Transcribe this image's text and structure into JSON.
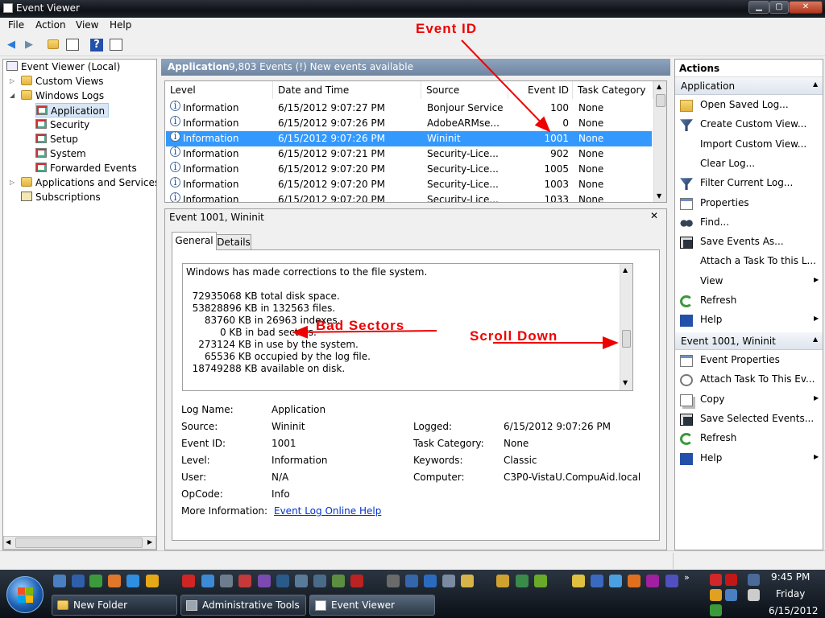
{
  "window": {
    "title": "Event Viewer",
    "min": "▁",
    "max": "▢",
    "close": "✕"
  },
  "menu": [
    "File",
    "Action",
    "View",
    "Help"
  ],
  "tree": {
    "root": "Event Viewer (Local)",
    "custom_views": "Custom Views",
    "windows_logs": "Windows Logs",
    "logs": [
      "Application",
      "Security",
      "Setup",
      "System",
      "Forwarded Events"
    ],
    "apps_services": "Applications and Services Lo",
    "subscriptions": "Subscriptions"
  },
  "center_header": {
    "title": "Application",
    "info": "9,803 Events (!) New events available"
  },
  "events_table": {
    "columns": [
      "Level",
      "Date and Time",
      "Source",
      "Event ID",
      "Task Category"
    ],
    "rows": [
      {
        "level": "Information",
        "date": "6/15/2012 9:07:27 PM",
        "source": "Bonjour Service",
        "id": "100",
        "cat": "None"
      },
      {
        "level": "Information",
        "date": "6/15/2012 9:07:26 PM",
        "source": "AdobeARMse...",
        "id": "0",
        "cat": "None"
      },
      {
        "level": "Information",
        "date": "6/15/2012 9:07:26 PM",
        "source": "Wininit",
        "id": "1001",
        "cat": "None",
        "selected": true
      },
      {
        "level": "Information",
        "date": "6/15/2012 9:07:21 PM",
        "source": "Security-Lice...",
        "id": "902",
        "cat": "None"
      },
      {
        "level": "Information",
        "date": "6/15/2012 9:07:20 PM",
        "source": "Security-Lice...",
        "id": "1005",
        "cat": "None"
      },
      {
        "level": "Information",
        "date": "6/15/2012 9:07:20 PM",
        "source": "Security-Lice...",
        "id": "1003",
        "cat": "None"
      },
      {
        "level": "Information",
        "date": "6/15/2012 9:07:20 PM",
        "source": "Security-Lice...",
        "id": "1033",
        "cat": "None"
      }
    ]
  },
  "detail": {
    "title": "Event 1001, Wininit",
    "close": "✕",
    "tabs": [
      "General",
      "Details"
    ],
    "description": [
      "Windows has made corrections to the file system.",
      "",
      "  72935068 KB total disk space.",
      "  53828896 KB in 132563 files.",
      "      83760 KB in 26963 indexes.",
      "           0 KB in bad sectors.",
      "    273124 KB in use by the system.",
      "      65536 KB occupied by the log file.",
      "  18749288 KB available on disk."
    ],
    "fields_left": [
      {
        "label": "Log Name:",
        "value": "Application"
      },
      {
        "label": "Source:",
        "value": "Wininit"
      },
      {
        "label": "Event ID:",
        "value": "1001"
      },
      {
        "label": "Level:",
        "value": "Information"
      },
      {
        "label": "User:",
        "value": "N/A"
      },
      {
        "label": "OpCode:",
        "value": "Info"
      },
      {
        "label": "More Information:",
        "value": "Event Log Online Help"
      }
    ],
    "fields_right": [
      {
        "label": "Logged:",
        "value": "6/15/2012 9:07:26 PM"
      },
      {
        "label": "Task Category:",
        "value": "None"
      },
      {
        "label": "Keywords:",
        "value": "Classic"
      },
      {
        "label": "Computer:",
        "value": "C3P0-VistaU.CompuAid.local"
      }
    ]
  },
  "annotations": {
    "event_id": "Event ID",
    "bad_sectors": "Bad Sectors",
    "scroll_down": "Scroll Down"
  },
  "actions": {
    "header": "Actions",
    "section1": "Application",
    "items1": [
      "Open Saved Log...",
      "Create Custom View...",
      "Import Custom View...",
      "Clear Log...",
      "Filter Current Log...",
      "Properties",
      "Find...",
      "Save Events As...",
      "Attach a Task To this L...",
      "View",
      "Refresh",
      "Help"
    ],
    "section2": "Event 1001, Wininit",
    "items2": [
      "Event Properties",
      "Attach Task To This Ev...",
      "Copy",
      "Save Selected Events...",
      "Refresh",
      "Help"
    ]
  },
  "taskbar": {
    "buttons": [
      "New Folder",
      "Administrative Tools",
      "Event Viewer"
    ],
    "time": "9:45 PM",
    "day": "Friday",
    "date": "6/15/2012"
  },
  "colors": {
    "selection": "#3399ff",
    "annotation": "#e00000",
    "link": "#0033cc"
  }
}
